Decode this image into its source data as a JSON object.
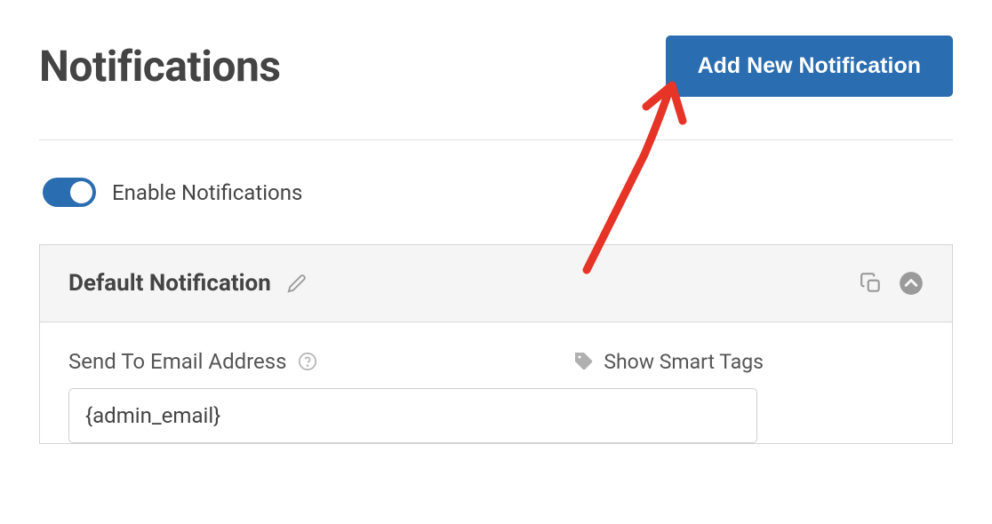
{
  "header": {
    "title": "Notifications",
    "add_button_label": "Add New Notification"
  },
  "toggle": {
    "label": "Enable Notifications",
    "enabled": true
  },
  "panel": {
    "title": "Default Notification",
    "fields": {
      "send_to": {
        "label": "Send To Email Address",
        "value": "{admin_email}",
        "smart_tags_label": "Show Smart Tags"
      }
    }
  }
}
